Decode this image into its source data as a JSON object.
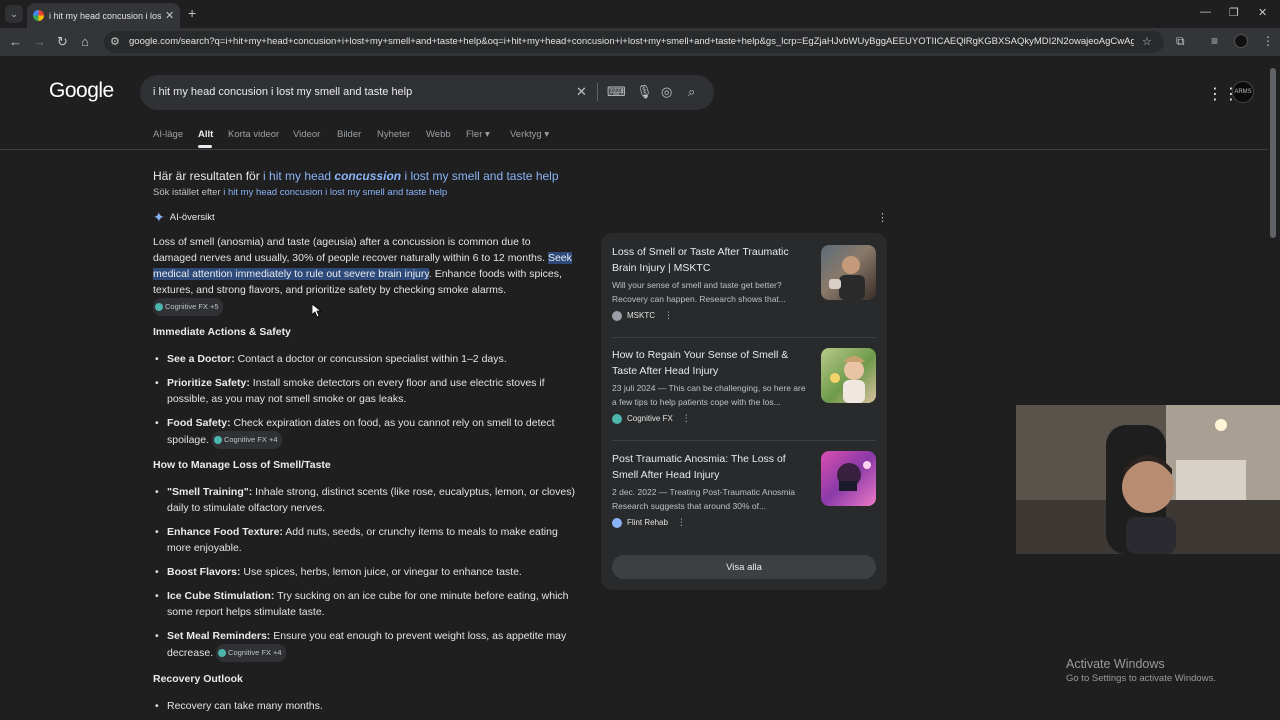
{
  "browser": {
    "tab_title": "i hit my head concusion i lost my smell and taste help",
    "url": "google.com/search?q=i+hit+my+head+concusion+i+lost+my+smell+and+taste+help&oq=i+hit+my+head+concusion+i+lost+my+smell+and+taste+help&gs_lcrp=EgZjaHJvbWUyBggAEEUYOTIICAEQlRgKGBXSAQkyMDI2N2owajeoAgCwAg..."
  },
  "google": {
    "logo": "Google",
    "query": "i hit my head concusion i lost my smell and taste help",
    "tabs": [
      "AI-läge",
      "Allt",
      "Korta videor",
      "Videor",
      "Bilder",
      "Nyheter",
      "Webb",
      "Fler",
      "Verktyg"
    ],
    "active_tab": "Allt",
    "avatar_text": "ARMS"
  },
  "correction": {
    "showing_prefix": "Här är resultaten för ",
    "showing_pre": "i hit my head ",
    "showing_bold": "concussion",
    "showing_post": " i lost my smell and taste help",
    "instead_prefix": "Sök istället efter ",
    "instead_link": "i hit my head concusion i lost my smell and taste help"
  },
  "ai_overview": {
    "label": "AI-översikt",
    "intro_1": "Loss of smell (anosmia) and taste (ageusia) after a concussion is common due to damaged nerves and usually, 30% of people recover naturally within 6 to 12 months. ",
    "intro_hl": "Seek medical attention immediately to rule out severe brain injury",
    "intro_2": ". Enhance foods with spices, textures, and strong flavors, and prioritize safety by checking smoke alarms. ",
    "chip_intro": "Cognitive FX +5",
    "section1": "Immediate Actions & Safety",
    "b1_bold": "See a Doctor:",
    "b1_text": " Contact a doctor or concussion specialist within 1–2 days.",
    "b2_bold": "Prioritize Safety:",
    "b2_text": " Install smoke detectors on every floor and use electric stoves if possible, as you may not smell smoke or gas leaks.",
    "b3_bold": "Food Safety:",
    "b3_text": " Check expiration dates on food, as you cannot rely on smell to detect spoilage. ",
    "chip_b3": "Cognitive FX +4",
    "section2": "How to Manage Loss of Smell/Taste",
    "b4_bold": "\"Smell Training\":",
    "b4_text": " Inhale strong, distinct scents (like rose, eucalyptus, lemon, or cloves) daily to stimulate olfactory nerves.",
    "b5_bold": "Enhance Food Texture:",
    "b5_text": " Add nuts, seeds, or crunchy items to meals to make eating more enjoyable.",
    "b6_bold": "Boost Flavors:",
    "b6_text": " Use spices, herbs, lemon juice, or vinegar to enhance taste.",
    "b7_bold": "Ice Cube Stimulation:",
    "b7_text": " Try sucking on an ice cube for one minute before eating, which some report helps stimulate taste.",
    "b8_bold": "Set Meal Reminders:",
    "b8_text": " Ensure you eat enough to prevent weight loss, as appetite may decrease. ",
    "chip_b8": "Cognitive FX +4",
    "section3": "Recovery Outlook",
    "b9_text": "Recovery can take many months."
  },
  "sources": [
    {
      "title": "Loss of Smell or Taste After Traumatic Brain Injury | MSKTC",
      "snippet": "Will your sense of smell and taste get better? Recovery can happen. Research shows that...",
      "site": "MSKTC",
      "color": "#9aa0a6"
    },
    {
      "title": "How to Regain Your Sense of Smell & Taste After Head Injury",
      "snippet": "23 juli 2024 — This can be challenging, so here are a few tips to help patients cope with the los...",
      "site": "Cognitive FX",
      "color": "#4db6ac"
    },
    {
      "title": "Post Traumatic Anosmia: The Loss of Smell After Head Injury",
      "snippet": "2 dec. 2022 — Treating Post-Traumatic Anosmia Research suggests that around 30% of...",
      "site": "Flint Rehab",
      "color": "#8ab4f8"
    }
  ],
  "show_all": "Visa alla",
  "watermark": {
    "line1": "Activate Windows",
    "line2": "Go to Settings to activate Windows."
  }
}
